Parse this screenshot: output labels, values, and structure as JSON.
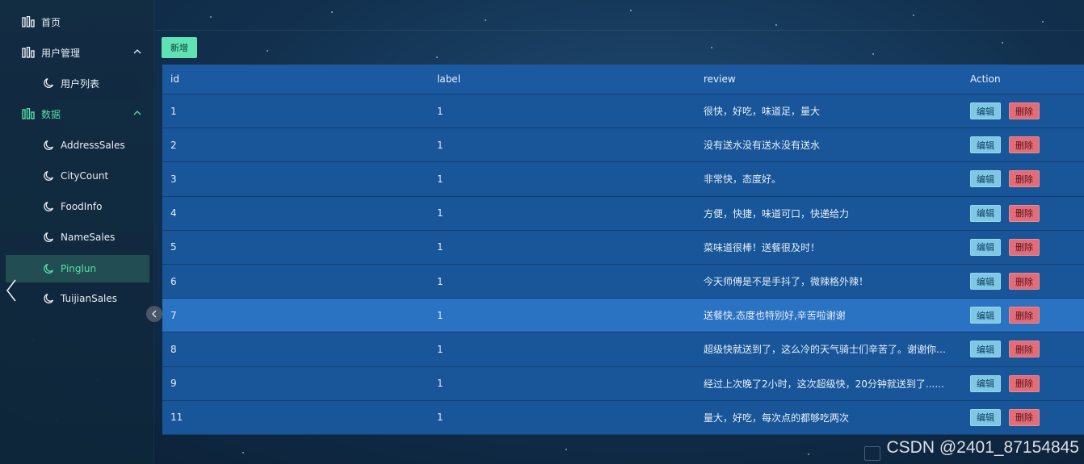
{
  "sidebar": {
    "items": [
      {
        "label": "首页",
        "icon": "bar-chart-icon",
        "level": 1
      },
      {
        "label": "用户管理",
        "icon": "bar-chart-icon",
        "level": 1,
        "expanded": true
      },
      {
        "label": "用户列表",
        "icon": "moon-icon",
        "level": 2
      },
      {
        "label": "数据",
        "icon": "bar-chart-icon",
        "level": 1,
        "expanded": true,
        "active_group": true
      },
      {
        "label": "AddressSales",
        "icon": "moon-icon",
        "level": 2
      },
      {
        "label": "CityCount",
        "icon": "moon-icon",
        "level": 2
      },
      {
        "label": "FoodInfo",
        "icon": "moon-icon",
        "level": 2
      },
      {
        "label": "NameSales",
        "icon": "moon-icon",
        "level": 2
      },
      {
        "label": "Pinglun",
        "icon": "moon-icon",
        "level": 2,
        "active": true
      },
      {
        "label": "TuijianSales",
        "icon": "moon-icon",
        "level": 2
      }
    ]
  },
  "toolbar": {
    "add_label": "新增"
  },
  "table": {
    "headers": {
      "id": "id",
      "label": "label",
      "review": "review",
      "action": "Action"
    },
    "edit_label": "编辑",
    "delete_label": "删除",
    "rows": [
      {
        "id": "1",
        "label": "1",
        "review": "很快，好吃，味道足，量大"
      },
      {
        "id": "2",
        "label": "1",
        "review": "没有送水没有送水没有送水"
      },
      {
        "id": "3",
        "label": "1",
        "review": "非常快，态度好。"
      },
      {
        "id": "4",
        "label": "1",
        "review": "方便，快捷，味道可口，快递给力"
      },
      {
        "id": "5",
        "label": "1",
        "review": "菜味道很棒！送餐很及时！"
      },
      {
        "id": "6",
        "label": "1",
        "review": "今天师傅是不是手抖了，微辣格外辣！"
      },
      {
        "id": "7",
        "label": "1",
        "review": "送餐快,态度也特别好,辛苦啦谢谢",
        "highlight": true
      },
      {
        "id": "8",
        "label": "1",
        "review": "超级快就送到了，这么冷的天气骑士们辛苦了。谢谢你们。麻..."
      },
      {
        "id": "9",
        "label": "1",
        "review": "经过上次晚了2小时，这次超级快，20分钟就送到了......"
      },
      {
        "id": "11",
        "label": "1",
        "review": "量大，好吃，每次点的都够吃两次"
      }
    ]
  },
  "watermark": "CSDN @2401_87154845",
  "colors": {
    "accent": "#55e0a6",
    "add_button": "#5fe3b5",
    "table": "#185699",
    "highlight_row": "#2a72c2",
    "edit": "#7ec8e6",
    "delete": "#e06d78"
  }
}
